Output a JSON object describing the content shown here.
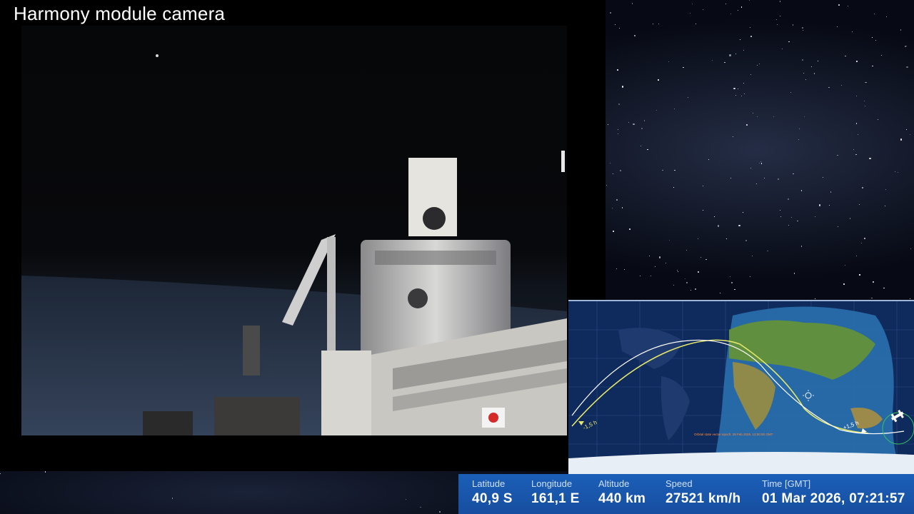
{
  "camera": {
    "title": "Harmony module camera"
  },
  "map": {
    "time_markers": [
      "-1,5 h",
      "+1,5 h"
    ],
    "caption": "Orbital state vector epoch: 28 Feb 2026, 12:00:00 GMT",
    "icons": [
      "sun-icon",
      "iss-icon"
    ],
    "colors": {
      "ocean": "#0f2a5c",
      "past_track": "#e6e86a",
      "future_track": "#ffffff",
      "night": "#0a1a3c"
    }
  },
  "telemetry": {
    "latitude": {
      "label": "Latitude",
      "value": "40,9 S"
    },
    "longitude": {
      "label": "Longitude",
      "value": "161,1 E"
    },
    "altitude": {
      "label": "Altitude",
      "value": "440 km"
    },
    "speed": {
      "label": "Speed",
      "value": "27521 km/h"
    },
    "time": {
      "label": "Time [GMT]",
      "value": "01 Mar 2026, 07:21:57"
    }
  }
}
